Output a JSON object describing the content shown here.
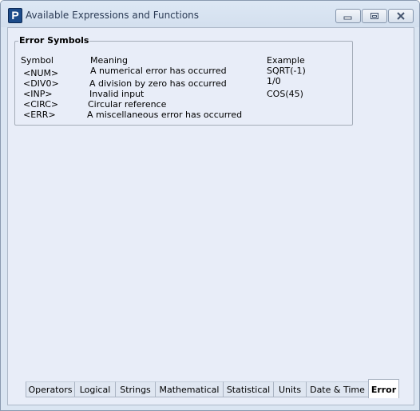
{
  "window": {
    "title": "Available Expressions and Functions",
    "icon_letter": "P"
  },
  "controls": {
    "minimize_icon": "minimize-icon",
    "maximize_icon": "maximize-icon",
    "close_icon": "close-icon"
  },
  "group": {
    "title": "Error Symbols",
    "headers": {
      "symbol": "Symbol",
      "meaning": "Meaning",
      "example": "Example"
    },
    "rows": [
      {
        "symbol": "<NUM>",
        "meaning": "A numerical error has occurred",
        "example": "SQRT(-1)"
      },
      {
        "symbol": "<DIV0>",
        "meaning": "A division by zero has occurred",
        "example": "1/0"
      },
      {
        "symbol": "<INP>",
        "meaning": "Invalid input",
        "example": "COS(45)"
      },
      {
        "symbol": "<CIRC>",
        "meaning": "Circular reference",
        "example": ""
      },
      {
        "symbol": "<ERR>",
        "meaning": "A miscellaneous error has occurred",
        "example": ""
      }
    ]
  },
  "tabs": [
    {
      "label": "Operators"
    },
    {
      "label": "Logical"
    },
    {
      "label": "Strings"
    },
    {
      "label": "Mathematical"
    },
    {
      "label": "Statistical"
    },
    {
      "label": "Units"
    },
    {
      "label": "Date & Time"
    },
    {
      "label": "Error",
      "active": true
    }
  ],
  "colors": {
    "window_bg": "#dae5f2",
    "client_bg": "#e8edf8",
    "icon_blue": "#1c4b8a"
  }
}
